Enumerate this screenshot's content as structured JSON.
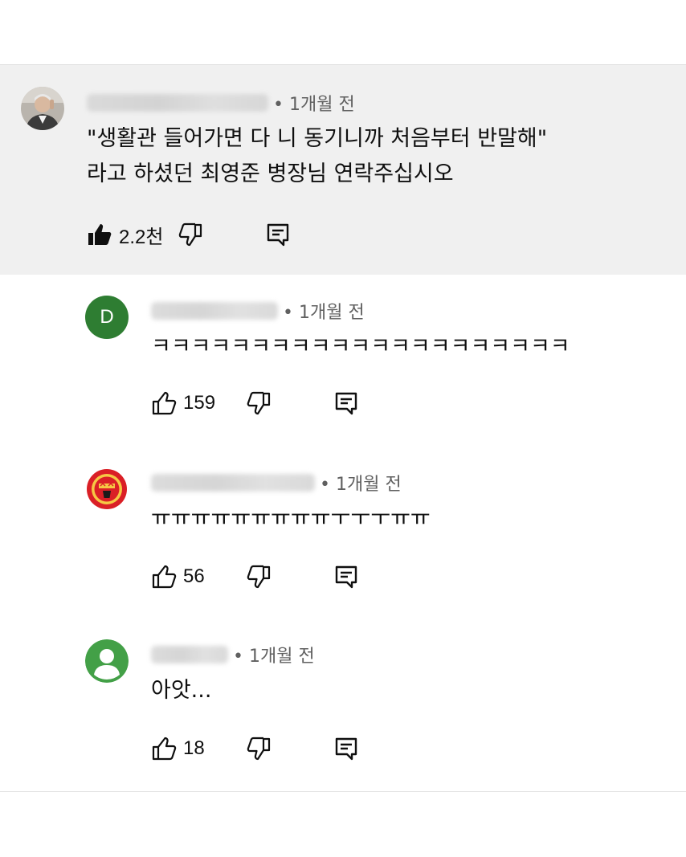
{
  "comments": [
    {
      "avatar": "photo-avatar",
      "time": "• 1개월 전",
      "text_lines": [
        "\"생활관 들어가면 다 니 동기니까 처음부터 반말해\"",
        "라고 하셨던 최영준 병장님 연락주십시오"
      ],
      "likes": "2.2천",
      "liked": true,
      "highlighted": true
    },
    {
      "avatar_letter": "D",
      "avatar_color": "#2e7d32",
      "time": "• 1개월 전",
      "text": "ㅋㅋㅋㅋㅋㅋㅋㅋㅋㅋㅋㅋㅋㅋㅋㅋㅋㅋㅋㅋㅋ",
      "likes": "159"
    },
    {
      "avatar": "manchester-united-crest",
      "time": "• 1개월 전",
      "text": "ㅠㅠㅠㅠㅠㅠㅠㅠㅠㅜㅜㅜㅠㅠ",
      "likes": "56"
    },
    {
      "avatar": "default-person-avatar",
      "avatar_color": "#43a047",
      "time": "• 1개월 전",
      "text": "아앗...",
      "likes": "18"
    }
  ],
  "icons": {
    "like": "thumbs-up-icon",
    "dislike": "thumbs-down-icon",
    "reply": "reply-comment-icon"
  }
}
